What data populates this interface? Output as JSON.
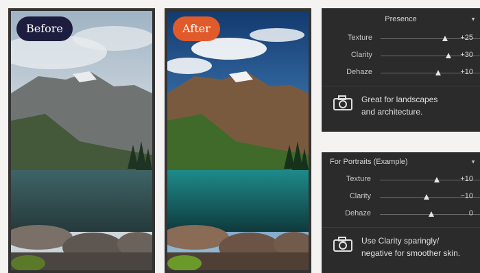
{
  "before_photo": {
    "label": "Before",
    "pill_color": "#1d1d3f"
  },
  "after_photo": {
    "label": "After",
    "pill_color": "#e05a2a"
  },
  "presence_panel": {
    "title": "Presence",
    "sliders": [
      {
        "label": "Texture",
        "value_text": "+25",
        "position": 0.62
      },
      {
        "label": "Clarity",
        "value_text": "+30",
        "position": 0.65
      },
      {
        "label": "Dehaze",
        "value_text": "+10",
        "position": 0.55
      }
    ],
    "tip_icon": "camera-icon",
    "tip_line1": "Great for landscapes",
    "tip_line2": "and architecture."
  },
  "portrait_panel": {
    "title": "For Portraits (Example)",
    "sliders": [
      {
        "label": "Texture",
        "value_text": "+10",
        "position": 0.55
      },
      {
        "label": "Clarity",
        "value_text": "−10",
        "position": 0.45
      },
      {
        "label": "Dehaze",
        "value_text": "0",
        "position": 0.5
      }
    ],
    "tip_icon": "camera-icon",
    "tip_line1": "Use Clarity sparingly/",
    "tip_line2": "negative for smoother skin."
  },
  "colors": {
    "panel_bg": "#2b2b2b",
    "frame": "#333333"
  }
}
